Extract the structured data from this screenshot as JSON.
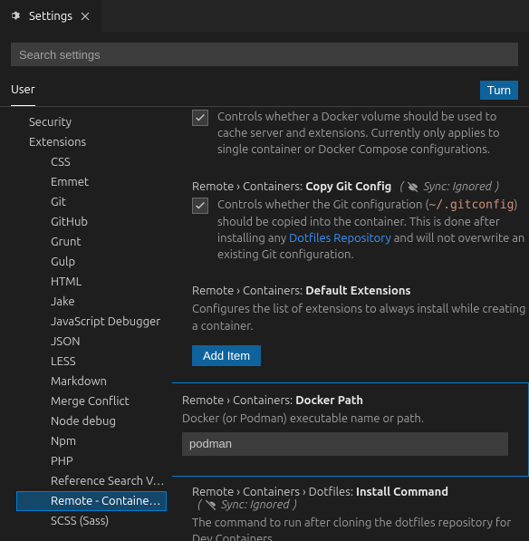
{
  "tab": {
    "title": "Settings"
  },
  "search": {
    "placeholder": "Search settings"
  },
  "scope": {
    "user": "User",
    "turn": "Turn"
  },
  "tree": {
    "security": "Security",
    "extensions": "Extensions",
    "items": {
      "css": "CSS",
      "emmet": "Emmet",
      "git": "Git",
      "github": "GitHub",
      "grunt": "Grunt",
      "gulp": "Gulp",
      "html": "HTML",
      "jake": "Jake",
      "jsdebug": "JavaScript Debugger",
      "json": "JSON",
      "less": "LESS",
      "markdown": "Markdown",
      "merge": "Merge Conflict",
      "nodedbg": "Node debug",
      "npm": "Npm",
      "php": "PHP",
      "refsearch": "Reference Search V…",
      "remote": "Remote - Containe…",
      "scss": "SCSS (Sass)"
    }
  },
  "settings": {
    "cacheVolume": {
      "desc": "Controls whether a Docker volume should be used to cache server and extensions. Currently only applies to single container or Docker Compose configurations."
    },
    "copyGit": {
      "crumb": "Remote › Containers: ",
      "name": "Copy Git Config",
      "sync": "Sync: Ignored",
      "desc1": "Controls whether the Git configuration (",
      "code": "~/.gitconfig",
      "desc2": ") should be copied into the container. This is done after installing any ",
      "link": "Dotfiles Repository",
      "desc3": " and will not overwrite an existing Git configuration."
    },
    "defaultExt": {
      "crumb": "Remote › Containers: ",
      "name": "Default Extensions",
      "desc": "Configures the list of extensions to always install while creating a container.",
      "addItem": "Add Item"
    },
    "dockerPath": {
      "crumb": "Remote › Containers: ",
      "name": "Docker Path",
      "desc": "Docker (or Podman) executable name or path.",
      "value": "podman"
    },
    "dotfiles": {
      "crumb": "Remote › Containers › Dotfiles: ",
      "name": "Install Command",
      "sync": "Sync: Ignored",
      "desc": "The command to run after cloning the dotfiles repository for Dev Containers."
    }
  }
}
